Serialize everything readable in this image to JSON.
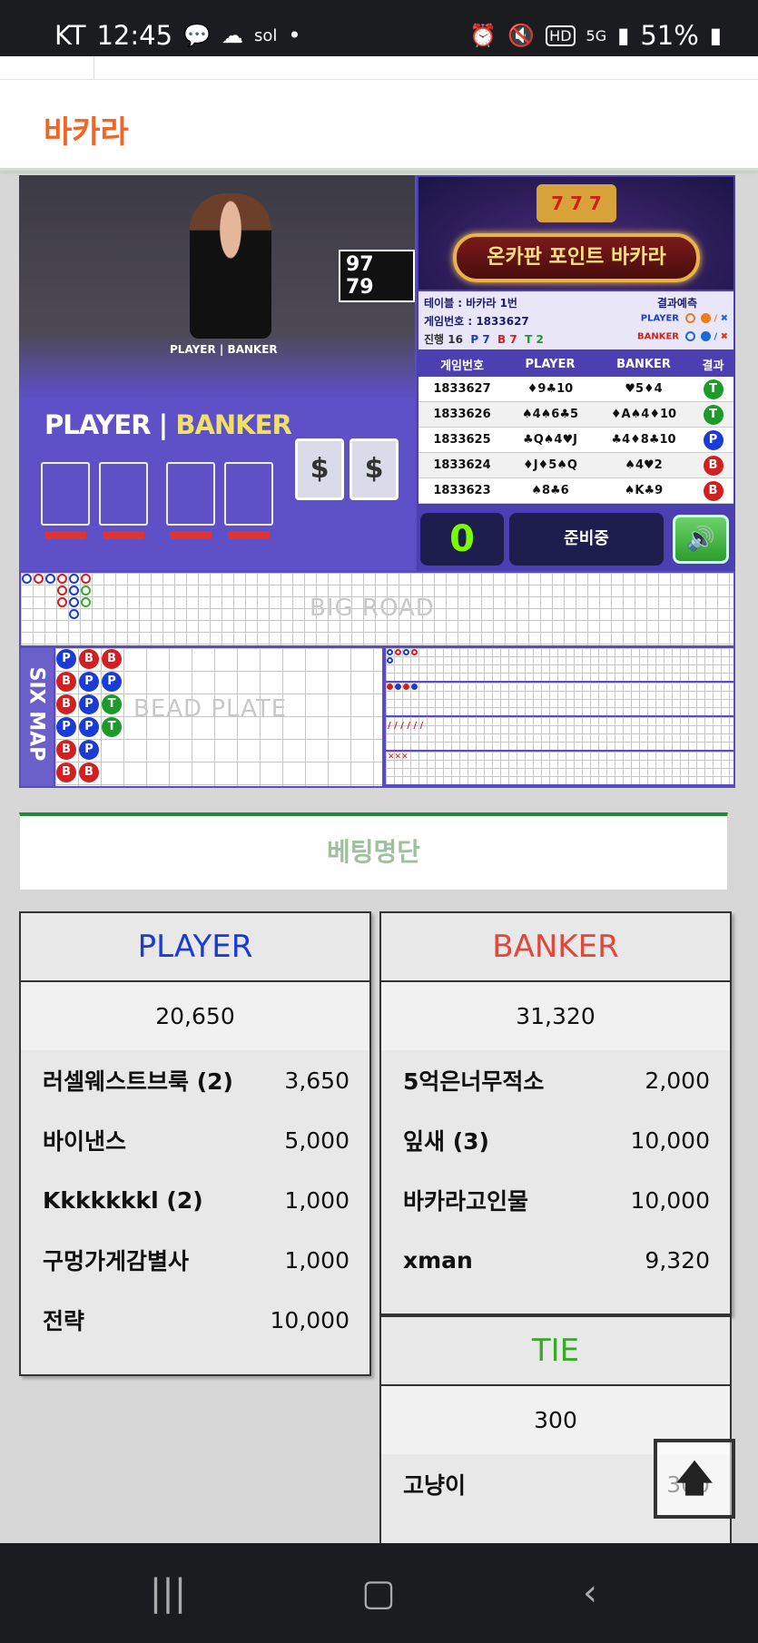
{
  "status_bar": {
    "carrier": "KT",
    "time": "12:45",
    "left_icons": [
      "chat-icon",
      "talk-icon",
      "sol-icon"
    ],
    "right_icons": [
      "alarm-icon",
      "mute-icon",
      "hd-icon",
      "5g-icon",
      "signal-icon"
    ],
    "battery": "51%"
  },
  "header": {
    "title": "바카라"
  },
  "video": {
    "scoreboard": "97 79",
    "table_small_label": "PLAYER | BANKER",
    "player_big": "PLAYER",
    "banker_big": "BANKER"
  },
  "banner": {
    "title": "온카판 포인트 바카라",
    "reel": "7 7 7"
  },
  "game_info": {
    "table": "테이블 : 바카라 1번",
    "game_no": "게임번호 : 1833627",
    "progress_label": "진행",
    "progress_count": "16",
    "p_count": "P 7",
    "b_count": "B 7",
    "t_count": "T 2",
    "prediction_label": "결과예측",
    "pred_player_label": "PLAYER",
    "pred_banker_label": "BANKER"
  },
  "history": {
    "headers": [
      "게임번호",
      "PLAYER",
      "BANKER",
      "결과"
    ],
    "rows": [
      {
        "no": "1833627",
        "player": "♦9♣10",
        "banker": "♥5♦4",
        "result": "T"
      },
      {
        "no": "1833626",
        "player": "♠4♠6♣5",
        "banker": "♦A♠4♦10",
        "result": "T"
      },
      {
        "no": "1833625",
        "player": "♣Q♠4♥J",
        "banker": "♣4♦8♣10",
        "result": "P"
      },
      {
        "no": "1833624",
        "player": "♦J♦5♠Q",
        "banker": "♠4♥2",
        "result": "B"
      },
      {
        "no": "1833623",
        "player": "♠8♣6",
        "banker": "♠K♣9",
        "result": "B"
      }
    ]
  },
  "controls": {
    "count": "0",
    "status": "준비중",
    "sound_icon": "speaker-icon"
  },
  "roads": {
    "big_road_label": "BIG ROAD",
    "bead_plate_label": "BEAD PLATE",
    "six_map_label": "SIX MAP",
    "bead_columns": [
      [
        "P",
        "B",
        "B",
        "P",
        "B",
        "B"
      ],
      [
        "B",
        "P",
        "P",
        "P",
        "P",
        "B"
      ],
      [
        "B",
        "P",
        "T",
        "T"
      ]
    ]
  },
  "betting": {
    "title": "베팅명단",
    "player": {
      "label": "PLAYER",
      "total": "20,650",
      "rows": [
        {
          "name": "러셀웨스트브룩 (2)",
          "amount": "3,650"
        },
        {
          "name": "바이낸스",
          "amount": "5,000"
        },
        {
          "name": "Kkkkkkkl (2)",
          "amount": "1,000"
        },
        {
          "name": "구멍가게감별사",
          "amount": "1,000"
        },
        {
          "name": "전략",
          "amount": "10,000"
        }
      ]
    },
    "banker": {
      "label": "BANKER",
      "total": "31,320",
      "rows": [
        {
          "name": "5억은너무적소",
          "amount": "2,000"
        },
        {
          "name": "잎새 (3)",
          "amount": "10,000"
        },
        {
          "name": "바카라고인물",
          "amount": "10,000"
        },
        {
          "name": "xman",
          "amount": "9,320"
        }
      ]
    },
    "tie": {
      "label": "TIE",
      "total": "300",
      "rows": [
        {
          "name": "고냥이",
          "amount": "300"
        }
      ]
    }
  },
  "colors": {
    "player": "#1a3bd6",
    "banker": "#e0483a",
    "tie": "#3aa82a",
    "title": "#f26522"
  },
  "nav": {
    "recent": "recent-apps-icon",
    "home": "home-icon",
    "back": "back-icon"
  }
}
